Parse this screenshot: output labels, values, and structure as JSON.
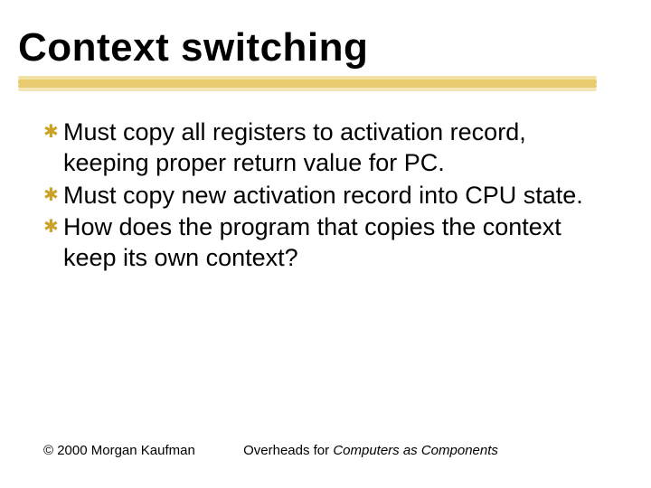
{
  "title": "Context switching",
  "bullets": [
    "Must copy all registers to activation record, keeping proper return value for PC.",
    "Must copy new activation record into CPU state.",
    "How does the program that copies the context keep its own context?"
  ],
  "footer": {
    "copyright": "© 2000 Morgan Kaufman",
    "center_prefix": "Overheads for ",
    "center_italic": "Computers as Components"
  }
}
